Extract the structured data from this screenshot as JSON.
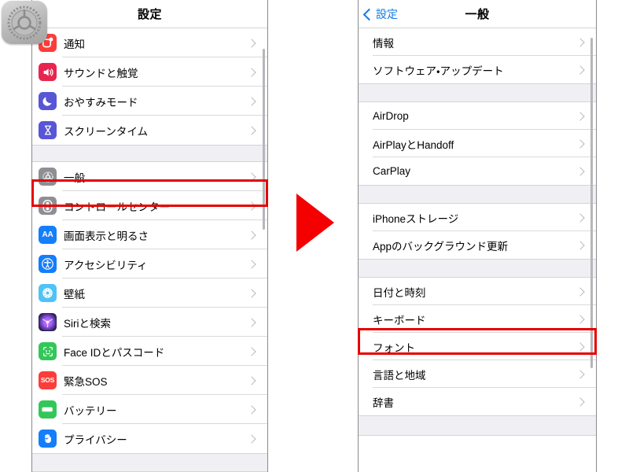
{
  "app_icon": {
    "name": "settings-app-icon",
    "color": "#b8b8b8"
  },
  "arrow": {
    "name": "red-right-arrow",
    "color": "#f50000"
  },
  "highlight_color": "#e60000",
  "left_panel": {
    "navbar": {
      "title": "設定"
    },
    "sections": [
      {
        "rows": [
          {
            "label": "通知",
            "icon": "notifications-icon",
            "icon_color": "#fc3d39",
            "highlighted": false
          },
          {
            "label": "サウンドと触覚",
            "icon": "sound-haptics-icon",
            "icon_color": "#e8254f",
            "highlighted": false
          },
          {
            "label": "おやすみモード",
            "icon": "do-not-disturb-icon",
            "icon_color": "#5856d6",
            "highlighted": false
          },
          {
            "label": "スクリーンタイム",
            "icon": "screen-time-icon",
            "icon_color": "#5856d6",
            "highlighted": false
          }
        ]
      },
      {
        "rows": [
          {
            "label": "一般",
            "icon": "general-gear-icon",
            "icon_color": "#8e8e93",
            "highlighted": true
          },
          {
            "label": "コントロールセンター",
            "icon": "control-center-icon",
            "icon_color": "#8e8e93",
            "highlighted": false
          },
          {
            "label": "画面表示と明るさ",
            "icon": "display-brightness-icon",
            "icon_color": "#147efb",
            "highlighted": false
          },
          {
            "label": "アクセシビリティ",
            "icon": "accessibility-icon",
            "icon_color": "#147efb",
            "highlighted": false
          },
          {
            "label": "壁紙",
            "icon": "wallpaper-icon",
            "icon_color": "#4fc3f7",
            "highlighted": false
          },
          {
            "label": "Siriと検索",
            "icon": "siri-search-icon",
            "icon_color": "#2b1f4e",
            "highlighted": false
          },
          {
            "label": "Face IDとパスコード",
            "icon": "face-id-passcode-icon",
            "icon_color": "#33c759",
            "highlighted": false
          },
          {
            "label": "緊急SOS",
            "icon": "emergency-sos-icon",
            "icon_color": "#fc3d39",
            "highlighted": false
          },
          {
            "label": "バッテリー",
            "icon": "battery-icon",
            "icon_color": "#33c759",
            "highlighted": false
          },
          {
            "label": "プライバシー",
            "icon": "privacy-hand-icon",
            "icon_color": "#147efb",
            "highlighted": false
          }
        ]
      }
    ]
  },
  "right_panel": {
    "navbar": {
      "back_label": "設定",
      "title": "一般",
      "back_icon": "chevron-left-icon"
    },
    "sections": [
      {
        "rows": [
          {
            "label": "情報",
            "highlighted": false
          },
          {
            "label": "ソフトウェア・アップデート",
            "highlighted": false
          }
        ]
      },
      {
        "rows": [
          {
            "label": "AirDrop",
            "highlighted": false
          },
          {
            "label": "AirPlayとHandoff",
            "highlighted": false
          },
          {
            "label": "CarPlay",
            "highlighted": false
          }
        ]
      },
      {
        "rows": [
          {
            "label": "iPhoneストレージ",
            "highlighted": false
          },
          {
            "label": "Appのバックグラウンド更新",
            "highlighted": false
          }
        ]
      },
      {
        "rows": [
          {
            "label": "日付と時刻",
            "highlighted": false
          },
          {
            "label": "キーボード",
            "highlighted": true
          },
          {
            "label": "フォント",
            "highlighted": false
          },
          {
            "label": "言語と地域",
            "highlighted": false
          },
          {
            "label": "辞書",
            "highlighted": false
          }
        ]
      }
    ]
  }
}
